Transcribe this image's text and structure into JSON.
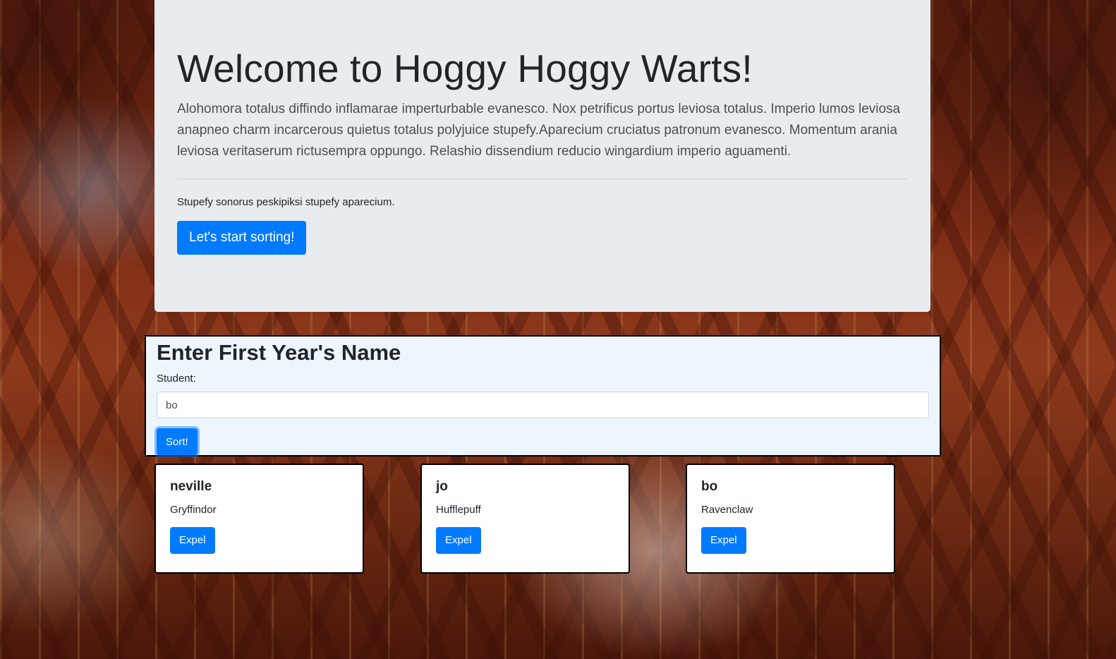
{
  "jumbotron": {
    "title": "Welcome to Hoggy Hoggy Warts!",
    "lead": "Alohomora totalus diffindo inflamarae imperturbable evanesco. Nox petrificus portus leviosa totalus. Imperio lumos leviosa anapneo charm incarcerous quietus totalus polyjuice stupefy.Aparecium cruciatus patronum evanesco. Momentum arania leviosa veritaserum rictusempra oppungo. Relashio dissendium reducio wingardium imperio aguamenti.",
    "subtext": "Stupefy sonorus peskipiksi stupefy aparecium.",
    "start_button": "Let's start sorting!"
  },
  "form": {
    "title": "Enter First Year's Name",
    "label": "Student:",
    "input_value": "bo",
    "sort_button": "Sort!"
  },
  "students": [
    {
      "name": "neville",
      "house": "Gryffindor",
      "expel_label": "Expel"
    },
    {
      "name": "jo",
      "house": "Hufflepuff",
      "expel_label": "Expel"
    },
    {
      "name": "bo",
      "house": "Ravenclaw",
      "expel_label": "Expel"
    }
  ],
  "colors": {
    "primary": "#007bff",
    "jumbotron_bg": "#e9ecef",
    "form_bg": "#eef6fd"
  }
}
